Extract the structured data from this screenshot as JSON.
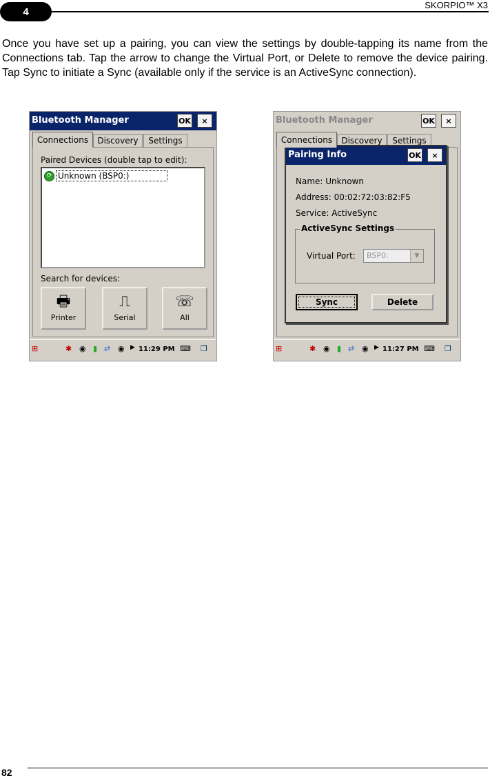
{
  "header": {
    "chapter": "4",
    "doc_title": "SKORPIO™ X3"
  },
  "body_text": "Once you have set up a pairing, you can view the settings by double-tapping its name from the Connections tab. Tap the arrow to change the Virtual Port, or Delete to remove the device pairing. Tap Sync to initiate a Sync (available only if the service is an ActiveSync connection).",
  "footer": {
    "page_number": "82"
  },
  "left_screen": {
    "title": "Bluetooth Manager",
    "ok_label": "OK",
    "close_label": "×",
    "tabs": [
      {
        "label": "Connections"
      },
      {
        "label": "Discovery"
      },
      {
        "label": "Settings"
      }
    ],
    "paired_label": "Paired Devices (double tap to edit):",
    "paired_devices": [
      {
        "label": "Unknown (BSP0:)"
      }
    ],
    "search_label": "Search for devices:",
    "device_buttons": [
      {
        "label": "Printer",
        "icon": "printer-icon"
      },
      {
        "label": "Serial",
        "icon": "serial-icon"
      },
      {
        "label": "All",
        "icon": "headset-phone-icon"
      }
    ],
    "time": "11:29 PM"
  },
  "right_screen": {
    "title": "Bluetooth Manager",
    "ok_label": "OK",
    "close_label": "×",
    "tabs": [
      {
        "label": "Connections"
      },
      {
        "label": "Discovery"
      },
      {
        "label": "Settings"
      }
    ],
    "dialog": {
      "title": "Pairing Info",
      "ok_label": "OK",
      "close_label": "×",
      "name": "Name:  Unknown",
      "address": "Address:  00:02:72:03:82:F5",
      "service": "Service:  ActiveSync",
      "group_title": "ActiveSync Settings",
      "virtual_port_label": "Virtual Port:",
      "virtual_port_value": "BSP0:",
      "sync_label": "Sync",
      "delete_label": "Delete"
    },
    "time": "11:27 PM"
  }
}
